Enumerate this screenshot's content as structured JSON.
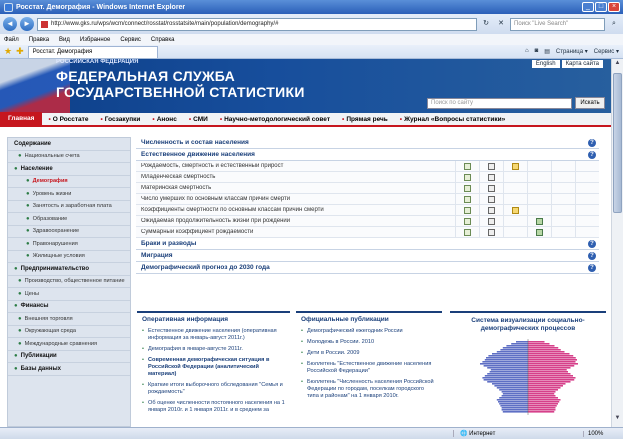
{
  "window": {
    "title": "Росстат. Демография - Windows Internet Explorer"
  },
  "address": {
    "url": "http://www.gks.ru/wps/wcm/connect/rosstat/rosstatsite/main/population/demography/#",
    "search_placeholder": "Поиск \"Live Search\""
  },
  "menu": [
    "Файл",
    "Правка",
    "Вид",
    "Избранное",
    "Сервис",
    "Справка"
  ],
  "tab": {
    "label": "Росстат. Демография"
  },
  "tab_tools": [
    "Страница ▾",
    "Сервис ▾"
  ],
  "banner": {
    "kicker": "РОССИЙСКАЯ ФЕДЕРАЦИЯ",
    "title_line1": "ФЕДЕРАЛЬНАЯ СЛУЖБА",
    "title_line2": "ГОСУДАРСТВЕННОЙ СТАТИСТИКИ",
    "link_english": "English",
    "link_sitemap": "Карта сайта",
    "search_placeholder": "Поиск по сайту",
    "search_button": "Искать"
  },
  "topnav": [
    "Главная",
    "О Росстате",
    "Госзакупки",
    "Анонс",
    "СМИ",
    "Научно-методологический совет",
    "Прямая речь",
    "Журнал «Вопросы статистики»"
  ],
  "sidebar": [
    {
      "label": "Содержание",
      "kind": "head"
    },
    {
      "label": "Национальные счета",
      "kind": "item"
    },
    {
      "label": "Население",
      "kind": "head"
    },
    {
      "label": "Демография",
      "kind": "sub-active"
    },
    {
      "label": "Уровень жизни",
      "kind": "sub"
    },
    {
      "label": "Занятость и заработная плата",
      "kind": "sub"
    },
    {
      "label": "Образование",
      "kind": "sub"
    },
    {
      "label": "Здравоохранение",
      "kind": "sub"
    },
    {
      "label": "Правонарушения",
      "kind": "sub"
    },
    {
      "label": "Жилищные условия",
      "kind": "sub"
    },
    {
      "label": "Предпринимательство",
      "kind": "head"
    },
    {
      "label": "Производство, общественное питание",
      "kind": "item"
    },
    {
      "label": "Цены",
      "kind": "item"
    },
    {
      "label": "Финансы",
      "kind": "head"
    },
    {
      "label": "Внешняя торговля",
      "kind": "item"
    },
    {
      "label": "Окружающая среда",
      "kind": "item"
    },
    {
      "label": "Международные сравнения",
      "kind": "item"
    },
    {
      "label": "Публикации",
      "kind": "head"
    },
    {
      "label": "Базы данных",
      "kind": "head"
    }
  ],
  "sections": {
    "population": "Численность и состав населения",
    "natural": "Естественное движение населения",
    "rows": [
      {
        "label": "Рождаемость, смертность и естественный прирост",
        "icons": [
          "table",
          "doc",
          "xls",
          "",
          "",
          ""
        ]
      },
      {
        "label": "Младенческая смертность",
        "icons": [
          "table",
          "doc",
          "",
          "",
          "",
          ""
        ]
      },
      {
        "label": "Материнская смертность",
        "icons": [
          "table",
          "doc",
          "",
          "",
          "",
          ""
        ]
      },
      {
        "label": "Число умерших по основным классам причин смерти",
        "icons": [
          "table",
          "doc",
          "",
          "",
          "",
          ""
        ]
      },
      {
        "label": "Коэффициенты смертности по основным классам причин смерти",
        "icons": [
          "table",
          "doc",
          "xls",
          "",
          "",
          ""
        ]
      },
      {
        "label": "Ожидаемая продолжительность жизни при рождении",
        "icons": [
          "table",
          "doc",
          "",
          "img",
          "",
          ""
        ]
      },
      {
        "label": "Суммарный коэффициент рождаемости",
        "icons": [
          "table",
          "doc",
          "",
          "img",
          "",
          ""
        ]
      }
    ],
    "marriage": "Браки и разводы",
    "migration": "Миграция",
    "forecast": "Демографический прогноз до 2030 года"
  },
  "panels": {
    "operative": {
      "title": "Оперативная информация",
      "items": [
        "Естественное движение населения (оперативная информация за январь-август 2011г.)",
        "Демография в январе-августе 2011г.",
        "Современная демографическая ситуация в Российской Федерации (аналитический материал)",
        "Краткие итоги выборочного обследования \"Семья и рождаемость\"",
        "Об оценке численности постоянного населения на 1 января 2010г. и 1 января 2011г. и в среднем за"
      ]
    },
    "publications": {
      "title": "Официальные публикации",
      "items": [
        "Демографический ежегодник России",
        "Молодежь в России. 2010",
        "Дети в России. 2009",
        "Бюллетень \"Естественное движение населения Российской Федерации\"",
        "Бюллетень \"Численность населения Российской Федерации по городам, поселкам городского типа и районам\" на 1 января 2010г."
      ]
    },
    "visual": {
      "title": "Система визуализации социально-демографических процессов"
    }
  },
  "status": {
    "text": "",
    "zone": "Интернет",
    "zoom": "100%"
  },
  "colors": {
    "accent_red": "#c6161e",
    "nav_blue": "#1a3f7a",
    "banner_blue": "#174e9c"
  }
}
